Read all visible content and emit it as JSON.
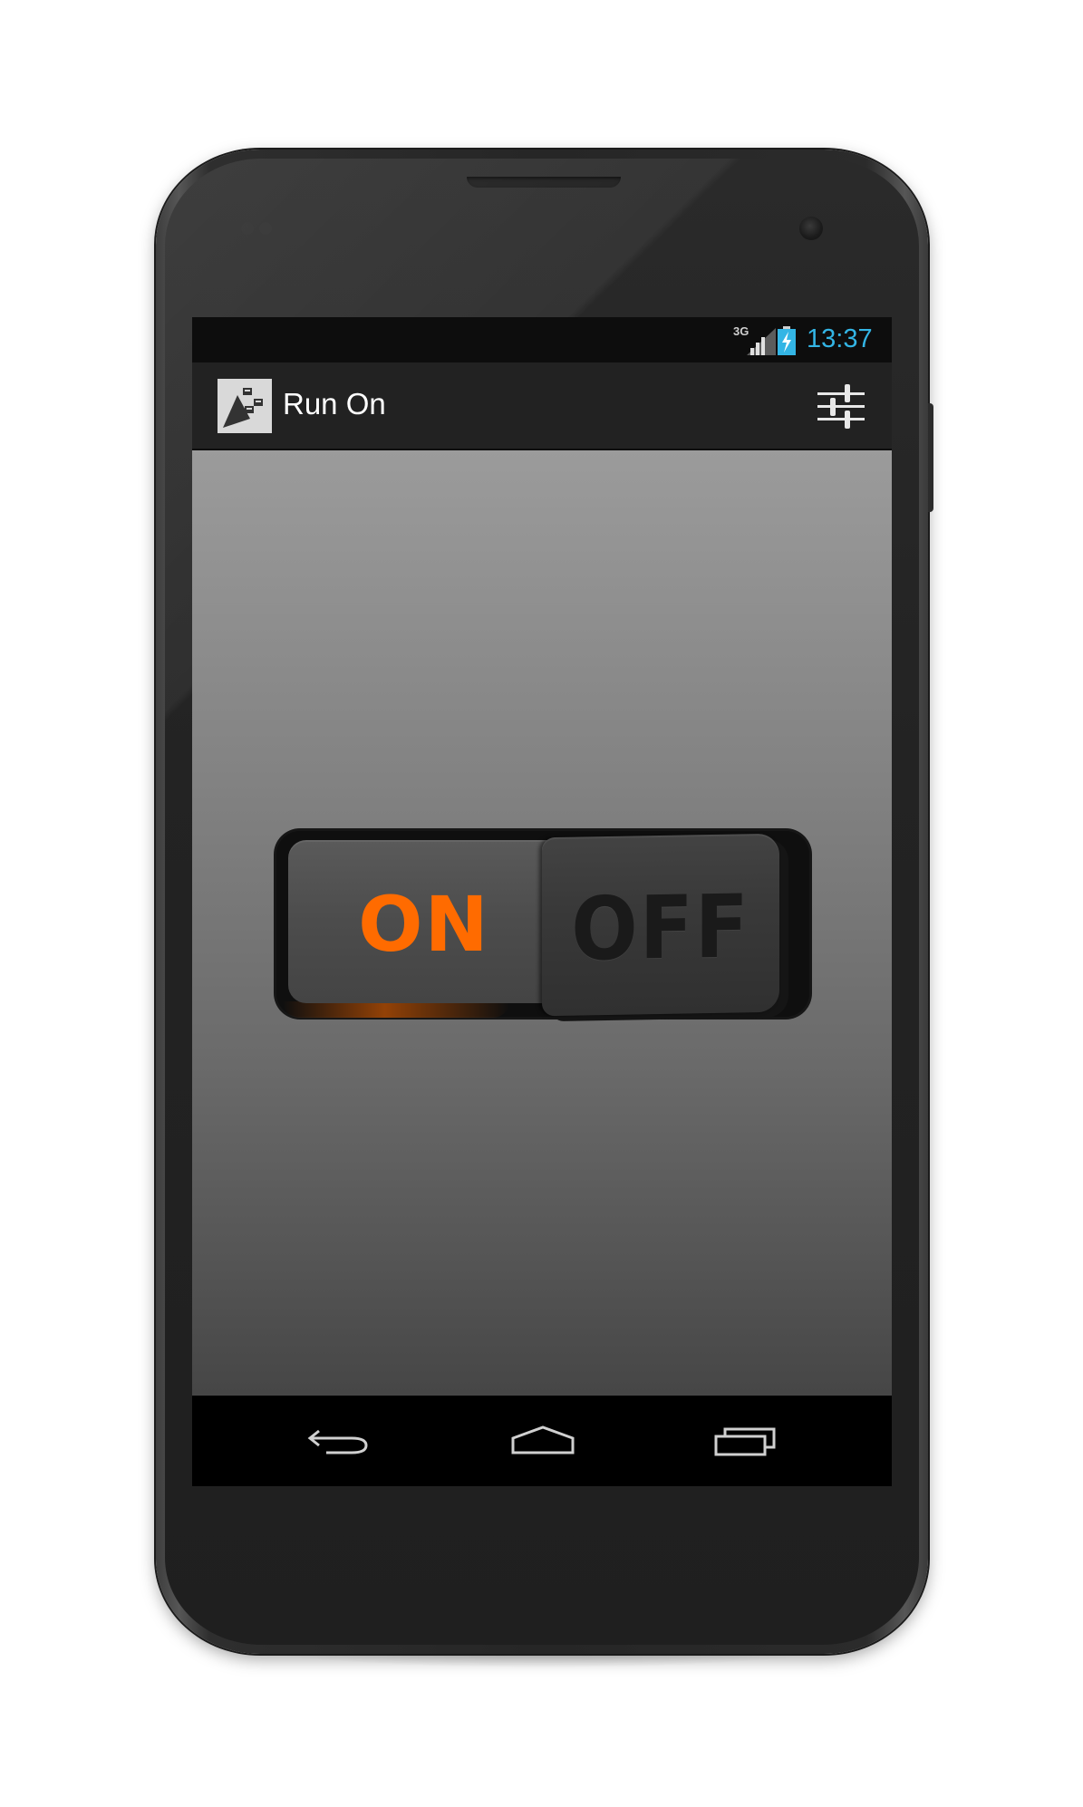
{
  "status_bar": {
    "network_type": "3G",
    "time": "13:37",
    "time_color": "#33b5e5",
    "icons": [
      "signal-icon",
      "battery-charging-icon"
    ]
  },
  "action_bar": {
    "app_icon": "app-logo-icon",
    "title": "Run On",
    "action_icon": "settings-sliders-icon"
  },
  "toggle": {
    "on_label": "ON",
    "off_label": "OFF",
    "on_color": "#ff6b00",
    "state": "ON"
  },
  "nav_bar": {
    "buttons": [
      "back-icon",
      "home-icon",
      "recent-apps-icon"
    ]
  }
}
